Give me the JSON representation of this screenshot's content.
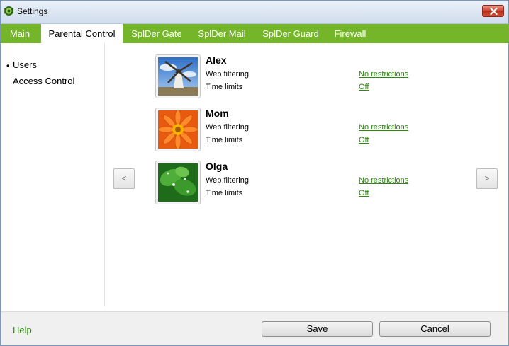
{
  "window": {
    "title": "Settings",
    "icon": "spider-icon"
  },
  "tabs": [
    {
      "label": "Main"
    },
    {
      "label": "Parental Control"
    },
    {
      "label": "SplDer Gate"
    },
    {
      "label": "SplDer Mail"
    },
    {
      "label": "SplDer Guard"
    },
    {
      "label": "Firewall"
    }
  ],
  "sidebar": {
    "items": [
      {
        "label": "Users"
      },
      {
        "label": "Access Control"
      }
    ],
    "bullet": "•"
  },
  "users": [
    {
      "name": "Alex",
      "web_label": "Web filtering",
      "web_value": "No restrictions",
      "time_label": "Time limits",
      "time_value": "Off",
      "avatar": "windmill-image"
    },
    {
      "name": "Mom",
      "web_label": "Web filtering",
      "web_value": "No restrictions",
      "time_label": "Time limits",
      "time_value": "Off",
      "avatar": "orange-flower-image"
    },
    {
      "name": "Olga",
      "web_label": "Web filtering",
      "web_value": "No restrictions",
      "time_label": "Time limits",
      "time_value": "Off",
      "avatar": "green-leaf-image"
    }
  ],
  "nav": {
    "prev": "<",
    "next": ">"
  },
  "footer": {
    "help": "Help",
    "save": "Save",
    "cancel": "Cancel"
  },
  "colors": {
    "tab_bar": "#74b52a",
    "link": "#2e8a0f"
  }
}
